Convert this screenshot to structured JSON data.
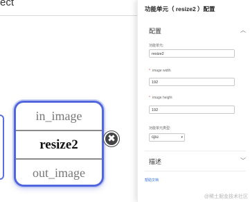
{
  "canvas": {
    "toolbar_title": "ect",
    "node": {
      "input_port": "in_image",
      "name": "resize2",
      "output_port": "out_image"
    },
    "delete_glyph": "✖"
  },
  "panel": {
    "title": "功能单元（ resize2 ）配置",
    "config_section": {
      "label": "配置",
      "chevron": "︿"
    },
    "fields": {
      "unit_name": {
        "label": "功能单元:",
        "value": "resize2"
      },
      "image_width": {
        "required_mark": "*",
        "label": "image width",
        "value": "192"
      },
      "image_height": {
        "required_mark": "*",
        "label": "image height",
        "value": "192"
      },
      "unit_type": {
        "label": "功能单元类型:",
        "value": "cpu",
        "arrow": "▾"
      }
    },
    "desc_section": {
      "label": "描述",
      "chevron": "﹀"
    },
    "help_link": "帮助文档",
    "watermark": "@稀土掘金技术社区"
  },
  "colors": {
    "node_border": "#5166dc",
    "required": "#e74c3c",
    "link": "#2f6de0"
  }
}
